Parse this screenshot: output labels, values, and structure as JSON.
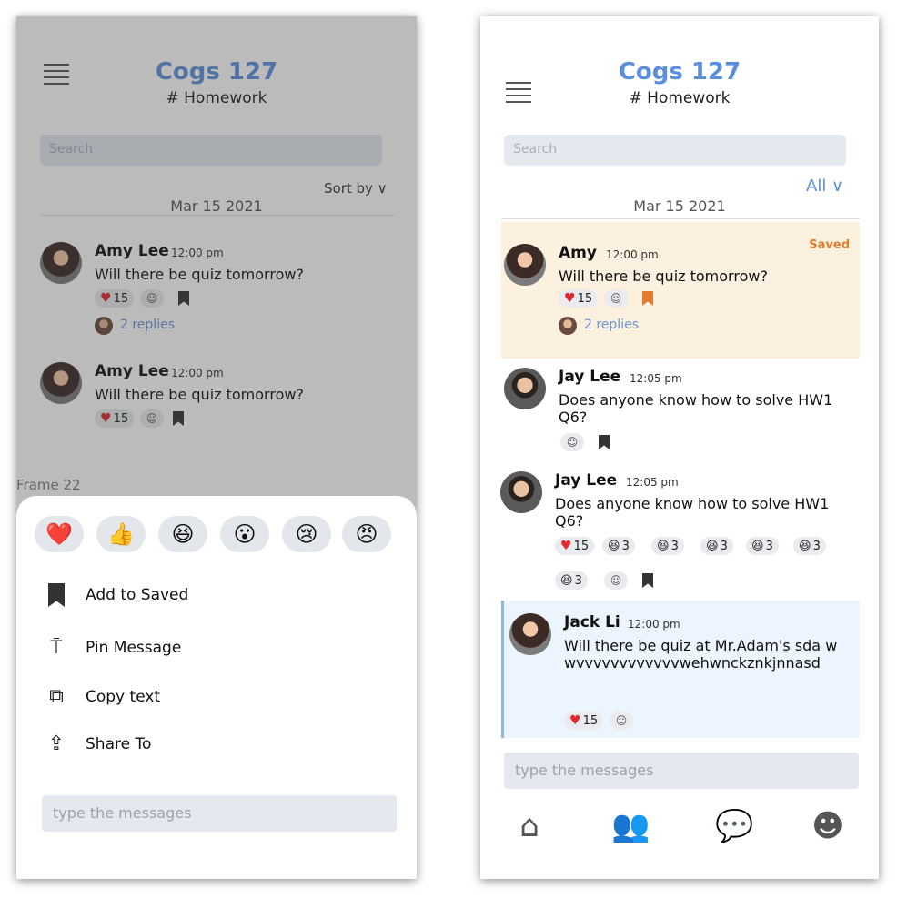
{
  "left": {
    "title": "Cogs 127",
    "subtitle": "# Homework",
    "search_placeholder": "Search",
    "sort_label": "Sort by ∨",
    "date": "Mar 15 2021",
    "messages": [
      {
        "name": "Amy Lee",
        "time": "12:00 pm",
        "text": "Will there be quiz tomorrow?",
        "heart_count": "15",
        "replies": "2 replies"
      },
      {
        "name": "Amy Lee",
        "time": "12:00 pm",
        "text": "Will there be quiz tomorrow?",
        "heart_count": "15"
      }
    ],
    "frame_label": "Frame 22",
    "emojis": [
      "❤️",
      "👍",
      "😆",
      "😮",
      "😢",
      "😠"
    ],
    "actions": [
      {
        "icon": "bookmark-icon",
        "label": "Add to Saved"
      },
      {
        "icon": "pin-icon",
        "label": "Pin Message"
      },
      {
        "icon": "copy-icon",
        "label": "Copy text"
      },
      {
        "icon": "share-icon",
        "label": "Share To"
      }
    ],
    "type_placeholder": "type the messages"
  },
  "right": {
    "title": "Cogs 127",
    "subtitle": "# Homework",
    "search_placeholder": "Search",
    "filter_label": "All ∨",
    "date": "Mar 15 2021",
    "saved_tag": "Saved",
    "messages": [
      {
        "name": "Amy",
        "time": "12:00 pm",
        "text": "Will there be quiz tomorrow?",
        "heart_count": "15",
        "replies": "2 replies"
      },
      {
        "name": "Jay Lee",
        "time": "12:05 pm",
        "text": "Does anyone know how to solve HW1 Q6?"
      },
      {
        "name": "Jay Lee",
        "time": "12:05 pm",
        "text": "Does anyone know how to solve HW1 Q6?",
        "heart_count": "15",
        "reaction_counts": [
          "3",
          "3",
          "3",
          "3",
          "3",
          "3"
        ]
      },
      {
        "name": "Jack Li",
        "time": "12:00 pm",
        "text": "Will there be quiz at Mr.Adam's  sda wwvvvvvvvvvvvvwehwnckznkjnnasd",
        "heart_count": "15"
      }
    ],
    "type_placeholder": "type the messages",
    "nav": [
      "home-icon",
      "people-icon",
      "chat-icon",
      "profile-icon"
    ]
  },
  "colors": {
    "accent": "#5b8fde",
    "saved": "#e37c2e",
    "heart": "#e0282e"
  }
}
